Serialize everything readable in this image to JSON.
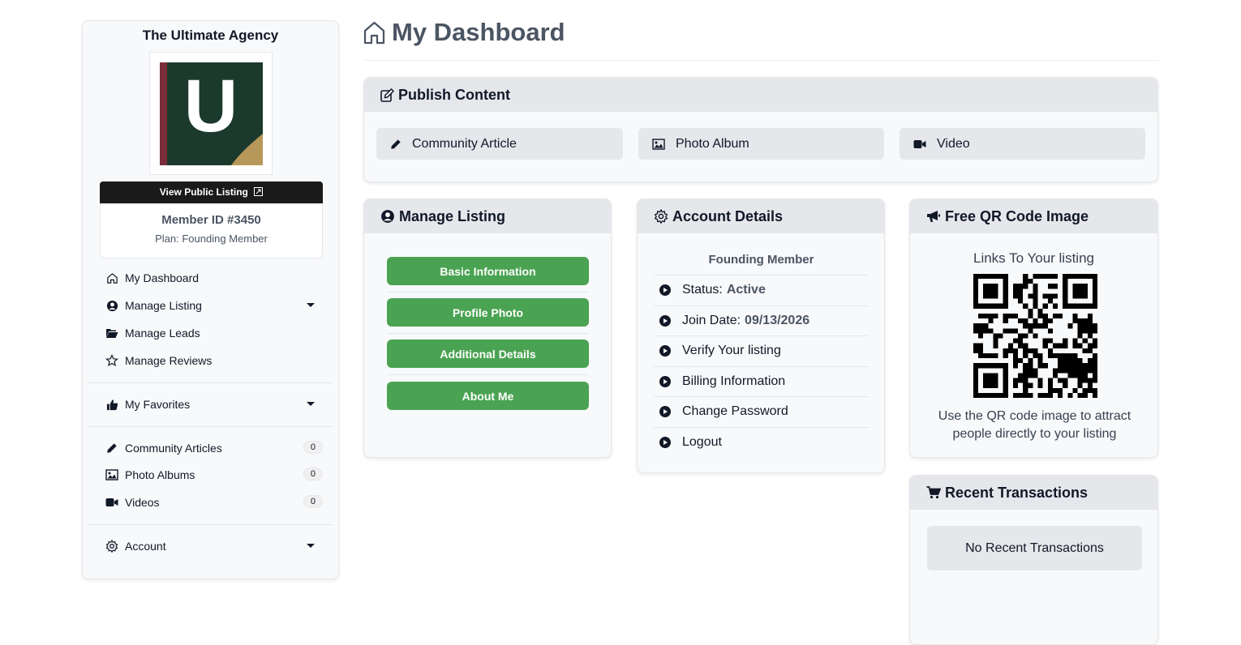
{
  "sidebar": {
    "agency_name": "The Ultimate Agency",
    "logo_letter": "U",
    "view_public_listing": "View Public Listing",
    "member_id": "Member ID #3450",
    "plan": "Plan: Founding Member",
    "nav": [
      {
        "label": "My Dashboard",
        "icon": "home-icon"
      },
      {
        "label": "Manage Listing",
        "icon": "user-circle-icon",
        "dropdown": true
      },
      {
        "label": "Manage Leads",
        "icon": "folder-open-icon"
      },
      {
        "label": "Manage Reviews",
        "icon": "star-icon"
      },
      {
        "label": "My Favorites",
        "icon": "thumbs-up-icon",
        "dropdown": true
      },
      {
        "label": "Community Articles",
        "icon": "pencil-icon",
        "count": "0"
      },
      {
        "label": "Photo Albums",
        "icon": "image-icon",
        "count": "0"
      },
      {
        "label": "Videos",
        "icon": "video-icon",
        "count": "0"
      },
      {
        "label": "Account",
        "icon": "gear-icon",
        "dropdown": true
      }
    ]
  },
  "header": {
    "title": "My Dashboard"
  },
  "publish": {
    "title": "Publish Content",
    "buttons": [
      {
        "label": "Community Article",
        "icon": "pencil-icon"
      },
      {
        "label": "Photo Album",
        "icon": "image-icon"
      },
      {
        "label": "Video",
        "icon": "video-icon"
      }
    ]
  },
  "manage_listing": {
    "title": "Manage Listing",
    "buttons": [
      "Basic Information",
      "Profile Photo",
      "Additional Details",
      "About Me"
    ]
  },
  "account_details": {
    "title": "Account Details",
    "plan_name": "Founding Member",
    "status_label": "Status:",
    "status_value": "Active",
    "join_label": "Join Date:",
    "join_value": "09/13/2026",
    "links": [
      "Verify Your listing",
      "Billing Information",
      "Change Password",
      "Logout"
    ]
  },
  "qr": {
    "title": "Free QR Code Image",
    "top_text": "Links To Your listing",
    "bottom_text": "Use the QR code image to attract people directly to your listing"
  },
  "transactions": {
    "title": "Recent Transactions",
    "empty_text": "No Recent Transactions"
  },
  "colors": {
    "accent_green": "#4aa352",
    "logo_green": "#1b3a2d",
    "logo_red": "#7a2e3a",
    "logo_gold": "#b8975a"
  }
}
